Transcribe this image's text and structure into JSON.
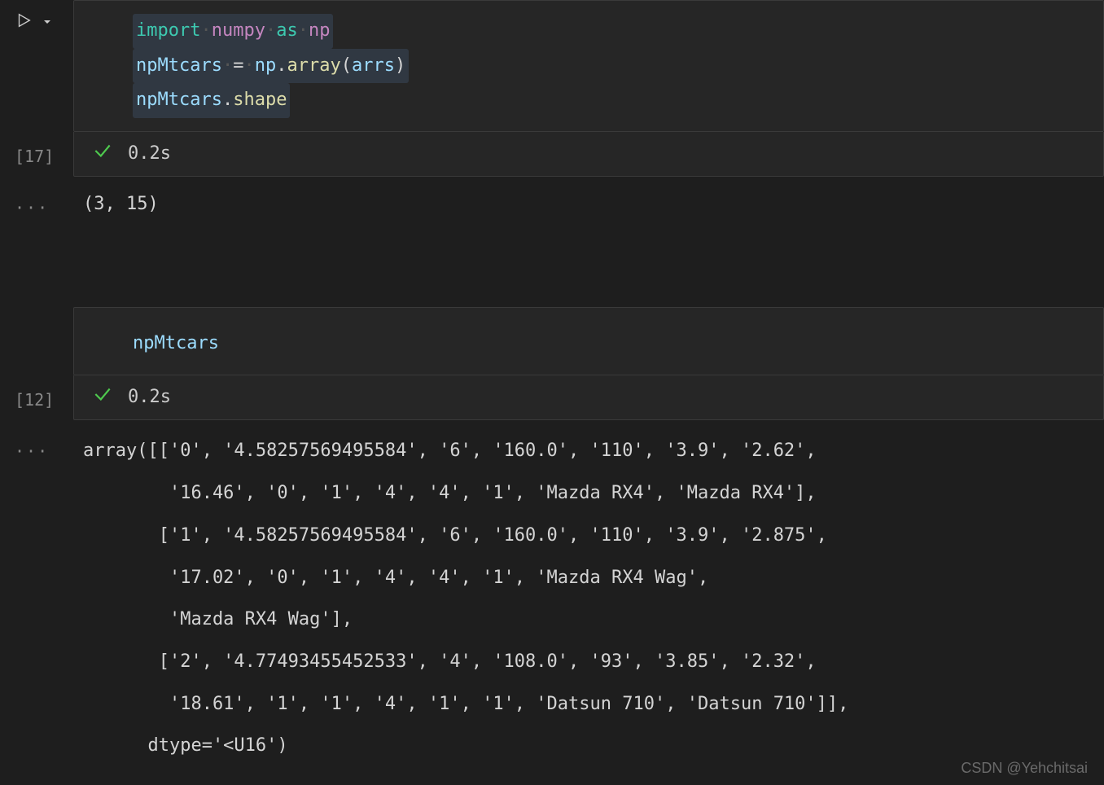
{
  "cell1": {
    "exec_count": "[17]",
    "time": "0.2s",
    "code": {
      "import_kw": "import",
      "module": "numpy",
      "as_kw": "as",
      "alias": "np",
      "line2_var": "npMtcars",
      "line2_eq": "=",
      "line2_ns": "np",
      "line2_func": "array",
      "line2_arg": "arrs",
      "line3_var": "npMtcars",
      "line3_prop": "shape"
    },
    "output": "(3, 15)"
  },
  "cell2": {
    "exec_count": "[12]",
    "time": "0.2s",
    "code": {
      "var": "npMtcars"
    },
    "output": "array([['0', '4.58257569495584', '6', '160.0', '110', '3.9', '2.62',\n        '16.46', '0', '1', '4', '4', '1', 'Mazda RX4', 'Mazda RX4'],\n       ['1', '4.58257569495584', '6', '160.0', '110', '3.9', '2.875',\n        '17.02', '0', '1', '4', '4', '1', 'Mazda RX4 Wag',\n        'Mazda RX4 Wag'],\n       ['2', '4.77493455452533', '4', '108.0', '93', '3.85', '2.32',\n        '18.61', '1', '1', '4', '1', '1', 'Datsun 710', 'Datsun 710']],\n      dtype='<U16')"
  },
  "watermark": "CSDN @Yehchitsai"
}
